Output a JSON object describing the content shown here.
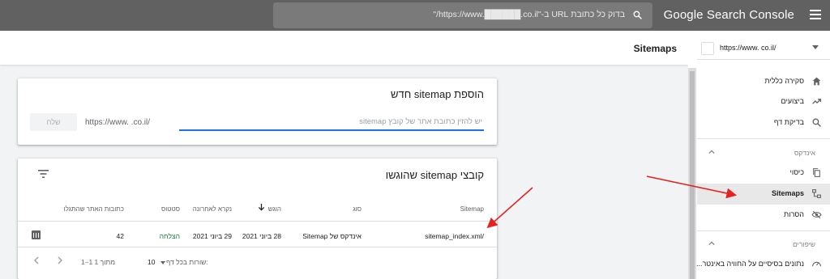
{
  "app": {
    "brand": "Google Search Console",
    "search_placeholder": "בדוק כל כתובת URL ב-\"https://www.██████.co.il/\""
  },
  "property": {
    "url": "https://www.          co.il/"
  },
  "sidebar": {
    "items": [
      {
        "label": "סקירה כללית",
        "icon": "home-icon"
      },
      {
        "label": "ביצועים",
        "icon": "trending-up-icon"
      },
      {
        "label": "בדיקת דף",
        "icon": "search-icon"
      }
    ],
    "index_section": "אינדקס",
    "index_items": [
      {
        "label": "כיסוי",
        "icon": "copy-icon"
      },
      {
        "label": "Sitemaps",
        "icon": "sitemap-icon",
        "active": true
      },
      {
        "label": "הסרות",
        "icon": "visibility-off-icon"
      }
    ],
    "enhancements_section": "שיפורים",
    "enhancement_items": [
      {
        "label": "נתונים בסיסיים על החוויה באינטר...",
        "icon": "gauge-icon"
      }
    ]
  },
  "page": {
    "title": "Sitemaps"
  },
  "add_card": {
    "title": "הוספת sitemap חדש",
    "url_prefix": "https://www.      .co.il/",
    "input_placeholder": "יש להזין כתובת אתר של קובץ sitemap",
    "submit_label": "שלח"
  },
  "submitted_card": {
    "title": "קובצי sitemap שהוגשו",
    "columns": [
      "Sitemap",
      "סוג",
      "הוגש",
      "נקרא לאחרונה",
      "סטטוס",
      "כתובות האתר שהתגלו"
    ],
    "rows": [
      {
        "sitemap": "/sitemap_index.xml",
        "type": "אינדקס של Sitemap",
        "submitted": "28 ביוני 2021",
        "last_read": "29 ביוני 2021",
        "status": "הצלחה",
        "discovered": "42"
      }
    ],
    "footer": {
      "rows_per_page_label": "שורות בכל דף:",
      "rows_per_page": "10",
      "range": "1–1 מתוך 1"
    }
  },
  "colors": {
    "topbar": "#616161",
    "accent": "#1a73e8",
    "success": "#188038",
    "annotation": "#e52222"
  }
}
